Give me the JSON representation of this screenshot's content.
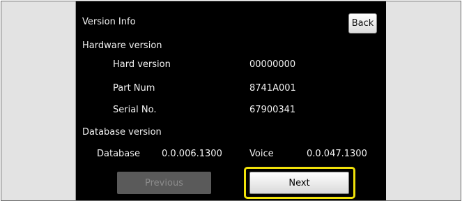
{
  "header": {
    "title": "Version Info",
    "back_label": "Back"
  },
  "hardware": {
    "section_label": "Hardware version",
    "rows": [
      {
        "label": "Hard version",
        "value": "00000000"
      },
      {
        "label": "Part Num",
        "value": "8741A001"
      },
      {
        "label": "Serial No.",
        "value": "67900341"
      }
    ]
  },
  "database": {
    "section_label": "Database version",
    "db_label": "Database",
    "db_value": "0.0.006.1300",
    "voice_label": "Voice",
    "voice_value": "0.0.047.1300"
  },
  "footer": {
    "previous_label": "Previous",
    "next_label": "Next"
  },
  "colors": {
    "highlight": "#f0e10a",
    "screen_bg": "#000000"
  }
}
